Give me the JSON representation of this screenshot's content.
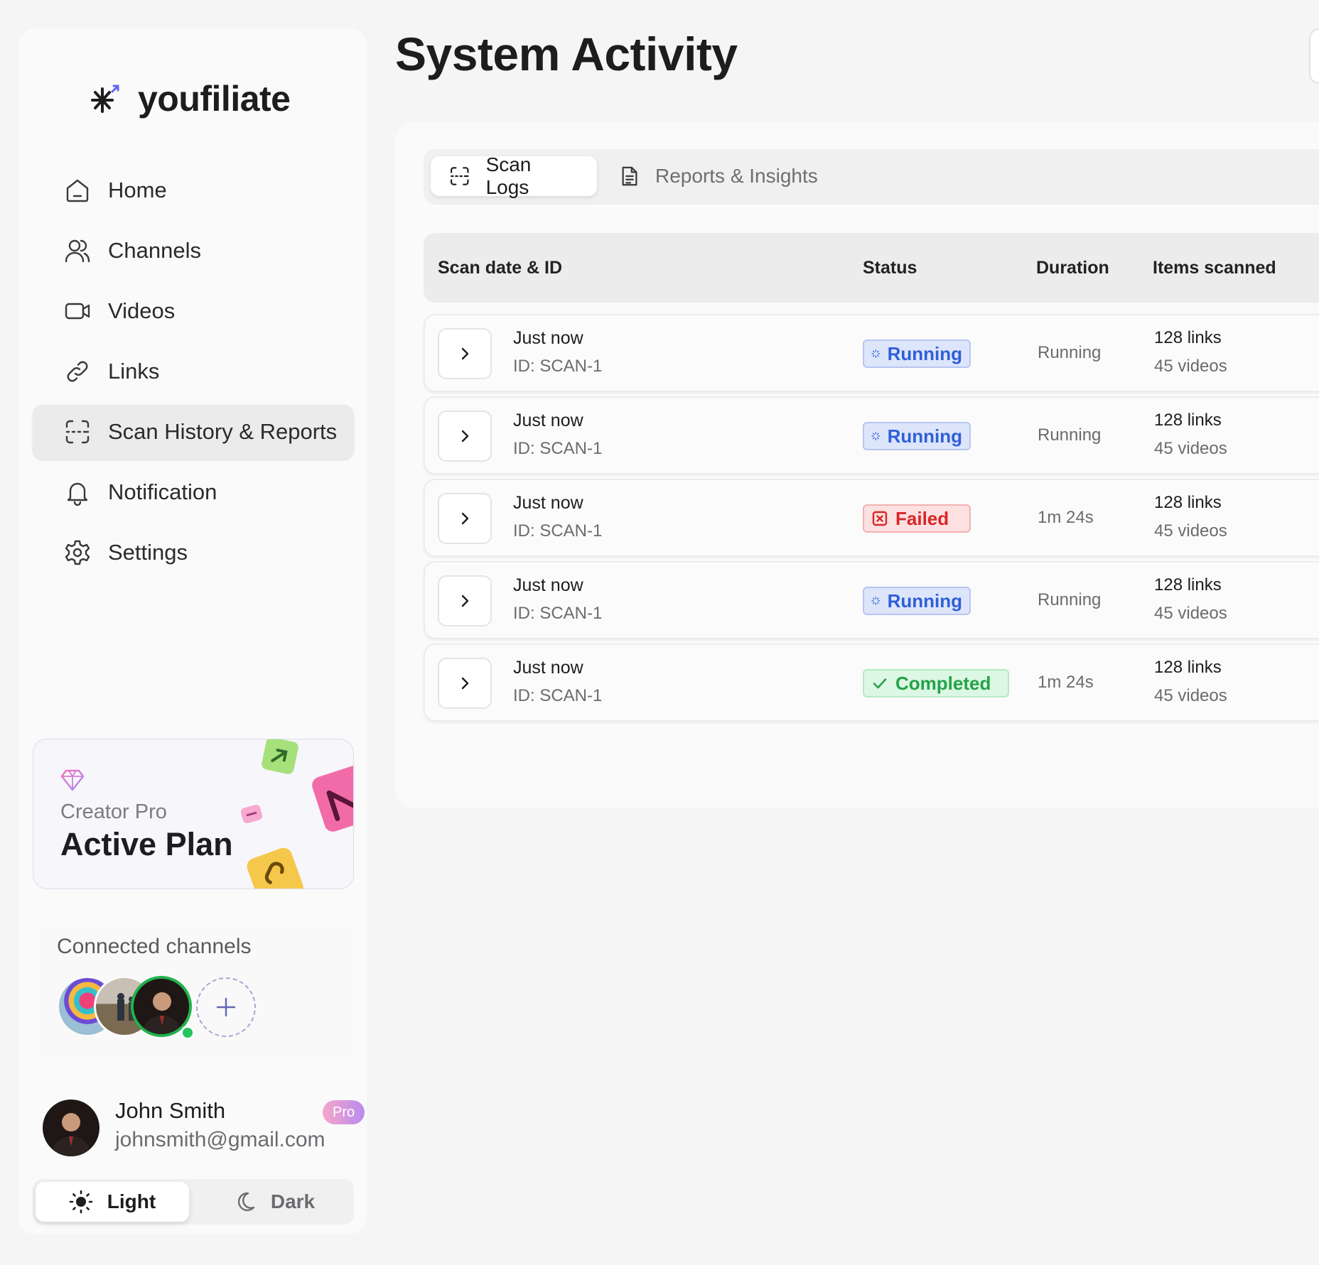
{
  "brand": {
    "name": "youfiliate",
    "icon": "asterisk-arrow-icon",
    "accent": "#6366f1"
  },
  "sidebar": {
    "nav": [
      {
        "label": "Home",
        "icon": "home-icon"
      },
      {
        "label": "Channels",
        "icon": "users-icon"
      },
      {
        "label": "Videos",
        "icon": "video-icon"
      },
      {
        "label": "Links",
        "icon": "link-icon"
      },
      {
        "label": "Scan History & Reports",
        "icon": "scan-icon",
        "active": true
      },
      {
        "label": "Notification",
        "icon": "bell-icon"
      },
      {
        "label": "Settings",
        "icon": "gear-icon"
      }
    ],
    "plan": {
      "tier": "Creator Pro",
      "name": "Active Plan",
      "icon": "gem-icon"
    },
    "channels": {
      "title": "Connected channels",
      "count": 3,
      "add_icon": "plus-icon"
    },
    "user": {
      "name": "John Smith",
      "email": "johnsmith@gmail.com",
      "badge": "Pro"
    },
    "theme": {
      "light": "Light",
      "dark": "Dark",
      "selected": "Light"
    }
  },
  "main": {
    "title": "System Activity",
    "tabs": [
      {
        "label": "Scan Logs",
        "icon": "scan-icon",
        "active": true
      },
      {
        "label": "Reports & Insights",
        "icon": "document-icon",
        "active": false
      }
    ],
    "table": {
      "columns": [
        "Scan date & ID",
        "Status",
        "Duration",
        "Items scanned"
      ],
      "rows": [
        {
          "date": "Just now",
          "id": "ID: SCAN-1",
          "status": "Running",
          "status_type": "running",
          "duration": "Running",
          "links": "128 links",
          "videos": "45 videos"
        },
        {
          "date": "Just now",
          "id": "ID: SCAN-1",
          "status": "Running",
          "status_type": "running",
          "duration": "Running",
          "links": "128 links",
          "videos": "45 videos"
        },
        {
          "date": "Just now",
          "id": "ID: SCAN-1",
          "status": "Failed",
          "status_type": "failed",
          "duration": "1m 24s",
          "links": "128 links",
          "videos": "45 videos"
        },
        {
          "date": "Just now",
          "id": "ID: SCAN-1",
          "status": "Running",
          "status_type": "running",
          "duration": "Running",
          "links": "128 links",
          "videos": "45 videos"
        },
        {
          "date": "Just now",
          "id": "ID: SCAN-1",
          "status": "Completed",
          "status_type": "completed",
          "duration": "1m 24s",
          "links": "128 links",
          "videos": "45 videos"
        }
      ]
    }
  },
  "colors": {
    "running": "#2f5fd7",
    "failed": "#d92626",
    "completed": "#23a348",
    "online": "#22c55e"
  }
}
